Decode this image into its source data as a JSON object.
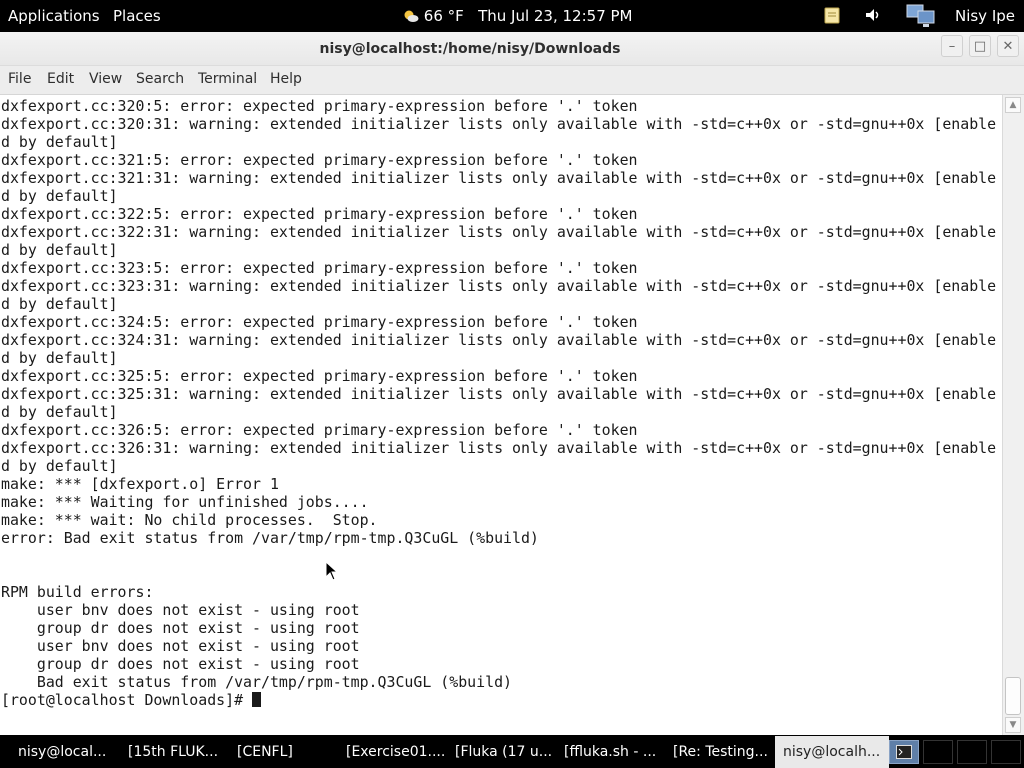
{
  "top_panel": {
    "applications_label": "Applications",
    "places_label": "Places",
    "weather": "66 °F",
    "datetime": "Thu Jul 23, 12:57 PM",
    "user_name": "Nisy Ipe"
  },
  "window": {
    "title": "nisy@localhost:/home/nisy/Downloads",
    "menu": [
      "File",
      "Edit",
      "View",
      "Search",
      "Terminal",
      "Help"
    ]
  },
  "terminal": {
    "lines": [
      "dxfexport.cc:320:5: error: expected primary-expression before '.' token",
      "dxfexport.cc:320:31: warning: extended initializer lists only available with -std=c++0x or -std=gnu++0x [enable",
      "d by default]",
      "dxfexport.cc:321:5: error: expected primary-expression before '.' token",
      "dxfexport.cc:321:31: warning: extended initializer lists only available with -std=c++0x or -std=gnu++0x [enable",
      "d by default]",
      "dxfexport.cc:322:5: error: expected primary-expression before '.' token",
      "dxfexport.cc:322:31: warning: extended initializer lists only available with -std=c++0x or -std=gnu++0x [enable",
      "d by default]",
      "dxfexport.cc:323:5: error: expected primary-expression before '.' token",
      "dxfexport.cc:323:31: warning: extended initializer lists only available with -std=c++0x or -std=gnu++0x [enable",
      "d by default]",
      "dxfexport.cc:324:5: error: expected primary-expression before '.' token",
      "dxfexport.cc:324:31: warning: extended initializer lists only available with -std=c++0x or -std=gnu++0x [enable",
      "d by default]",
      "dxfexport.cc:325:5: error: expected primary-expression before '.' token",
      "dxfexport.cc:325:31: warning: extended initializer lists only available with -std=c++0x or -std=gnu++0x [enable",
      "d by default]",
      "dxfexport.cc:326:5: error: expected primary-expression before '.' token",
      "dxfexport.cc:326:31: warning: extended initializer lists only available with -std=c++0x or -std=gnu++0x [enable",
      "d by default]",
      "make: *** [dxfexport.o] Error 1",
      "make: *** Waiting for unfinished jobs....",
      "make: *** wait: No child processes.  Stop.",
      "error: Bad exit status from /var/tmp/rpm-tmp.Q3CuGL (%build)",
      "",
      "",
      "RPM build errors:",
      "    user bnv does not exist - using root",
      "    group dr does not exist - using root",
      "    user bnv does not exist - using root",
      "    group dr does not exist - using root",
      "    Bad exit status from /var/tmp/rpm-tmp.Q3CuGL (%build)",
      "[root@localhost Downloads]#"
    ],
    "prompt": "[root@localhost Downloads]# "
  },
  "taskbar": {
    "tasks": [
      "nisy@local...",
      "[15th FLUK...",
      "[CENFL]",
      "[Exercise01....",
      "[Fluka (17 u...",
      "[ffluka.sh - ...",
      "[Re: Testing...",
      "nisy@localh..."
    ]
  },
  "icons": {
    "weather": "weather-sun-cloud-icon",
    "notes": "notes-icon",
    "volume": "volume-icon",
    "network": "network-icon",
    "terminal": "terminal-icon"
  },
  "colors": {
    "panel_bg": "#000000",
    "terminal_bg": "#ffffff",
    "terminal_fg": "#1a1a1a",
    "active_task_bg": "#e9e9e9"
  }
}
